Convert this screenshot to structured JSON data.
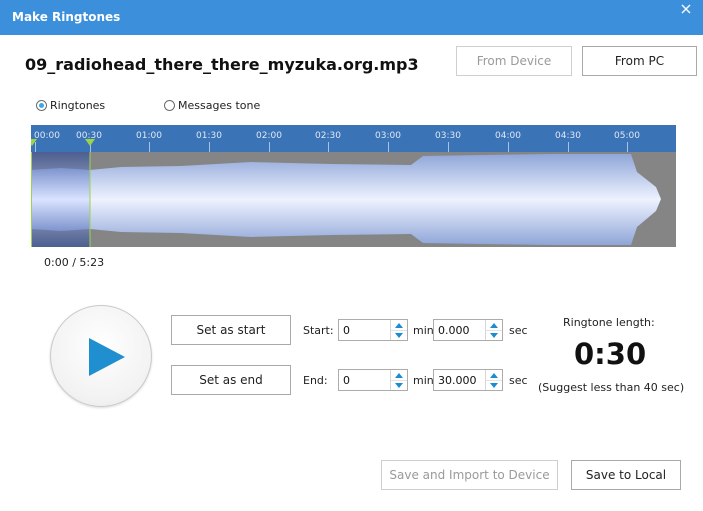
{
  "window": {
    "title": "Make Ringtones"
  },
  "file": {
    "name": "09_radiohead_there_there_myzuka.org.mp3"
  },
  "source_buttons": {
    "from_device": "From Device",
    "from_pc": "From PC"
  },
  "mode": {
    "ringtones": "Ringtones",
    "messages_tone": "Messages tone",
    "selected": "Ringtones"
  },
  "timeline": {
    "ticks": [
      "00:00",
      "00:30",
      "01:00",
      "01:30",
      "02:00",
      "02:30",
      "03:00",
      "03:30",
      "04:00",
      "04:30",
      "05:00"
    ]
  },
  "playback": {
    "position": "0:00 / 5:23"
  },
  "controls": {
    "set_start": "Set as start",
    "set_end": "Set as end",
    "start_label": "Start:",
    "end_label": "End:",
    "min_label": "min",
    "sec_label": "sec",
    "start_min": "0",
    "start_sec": "0.000",
    "end_min": "0",
    "end_sec": "30.000"
  },
  "ringtone": {
    "length_label": "Ringtone length:",
    "length_value": "0:30",
    "hint": "(Suggest less than 40 sec)"
  },
  "footer": {
    "save_import": "Save and Import to Device",
    "save_local": "Save to Local"
  },
  "colors": {
    "titlebar": "#3c8fdb",
    "accent": "#3aa7e8",
    "play_icon": "#1f8fcf",
    "timeline": "#3b73b7",
    "marker": "#9bd44a"
  }
}
